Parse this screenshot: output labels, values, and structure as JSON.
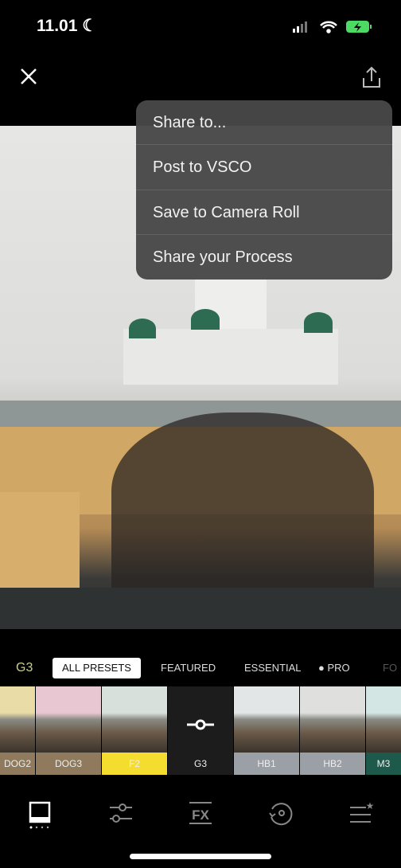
{
  "status": {
    "time": "11.01",
    "moon_icon": "moon-icon",
    "battery": "charging"
  },
  "header": {
    "close_icon": "close-icon",
    "share_icon": "share-icon"
  },
  "share_menu": {
    "items": [
      "Share to...",
      "Post to VSCO",
      "Save to Camera Roll",
      "Share your Process"
    ]
  },
  "presets": {
    "current": "G3",
    "tabs": [
      "ALL PRESETS",
      "FEATURED",
      "ESSENTIAL",
      "PRO",
      "FO"
    ],
    "selected_tab": "ALL PRESETS",
    "thumbnails": [
      {
        "label": "DOG2",
        "color": "#8f7a5e",
        "tint": "#e9dca6"
      },
      {
        "label": "DOG3",
        "color": "#8f7a5e",
        "tint": "#e8c7d2"
      },
      {
        "label": "F2",
        "color": "#f5dd30",
        "tint": "#d8e0dc"
      },
      {
        "label": "G3",
        "color": "#1c1c1c",
        "tint": "#1c1c1c"
      },
      {
        "label": "HB1",
        "color": "#9aa0a6",
        "tint": "#e2e6e6"
      },
      {
        "label": "HB2",
        "color": "#9aa0a6",
        "tint": "#dfe0dd"
      },
      {
        "label": "M3",
        "color": "#1e5a4c",
        "tint": "#d4e6e4"
      }
    ]
  },
  "toolbar": {
    "icons": [
      "presets-icon",
      "adjust-sliders-icon",
      "fx-icon",
      "history-icon",
      "recipes-icon"
    ]
  },
  "colors": {
    "accent_current": "#c8d08a",
    "menu_bg": "#484848"
  }
}
